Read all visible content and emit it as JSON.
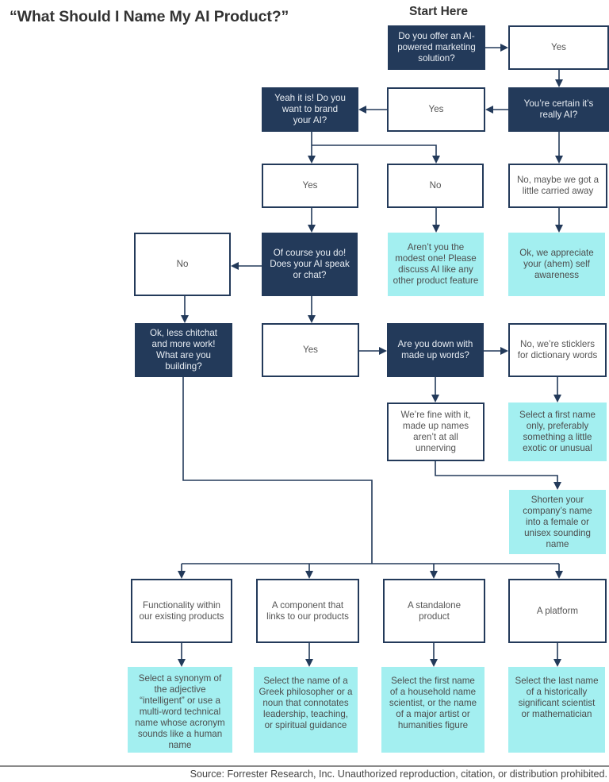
{
  "title": "“What Should I Name My AI Product?”",
  "start_label": "Start Here",
  "colors": {
    "question_box": "#233a5a",
    "answer_box_border": "#233a5a",
    "recommendation_box": "#a3eff0",
    "connector": "#233a5a"
  },
  "nodes": {
    "q_marketing": "Do you offer an AI-powered marketing solution?",
    "a_yes_marketing": "Yes",
    "q_certain": "You’re certain it’s really AI?",
    "a_yes_certain": "Yes",
    "a_no_certain": "No, maybe we got a little carried away",
    "r_self_awareness": "Ok, we appreciate your (ahem) self awareness",
    "q_brand": "Yeah it is! Do you want to brand your AI?",
    "a_yes_brand": "Yes",
    "a_no_brand": "No",
    "r_modest": "Aren’t you the modest one! Please discuss AI like any other product feature",
    "q_speak": "Of course you do! Does your AI speak or chat?",
    "a_no_speak": "No",
    "a_yes_speak": "Yes",
    "q_building": "Ok, less chitchat and more work! What are you building?",
    "q_made_up": "Are you down with made up words?",
    "a_no_made_up": "No, we’re sticklers for dictionary words",
    "r_first_name": "Select a first name only, preferably something a little exotic or unusual",
    "a_yes_made_up": "We’re fine with it, made up names aren’t at all unnerving",
    "r_shorten": "Shorten your company’s name into a female or unisex sounding name",
    "a_functionality": "Functionality within our existing products",
    "a_component": "A component that links to our products",
    "a_standalone": "A standalone product",
    "a_platform": "A platform",
    "r_synonym": "Select a synonym of the adjective “intelligent” or use a multi-word technical name whose acronym sounds like a human name",
    "r_greek": "Select the name of a Greek philosopher or a noun that connotates leadership, teaching, or spiritual guidance",
    "r_scientist_first": "Select the first name of a household name scientist, or the name of a major artist or humanities figure",
    "r_scientist_last": "Select the last name of a historically significant scientist or mathematician"
  },
  "footer": {
    "source": "Source: Forrester Research, Inc. Unauthorized reproduction, citation, or distribution prohibited."
  }
}
